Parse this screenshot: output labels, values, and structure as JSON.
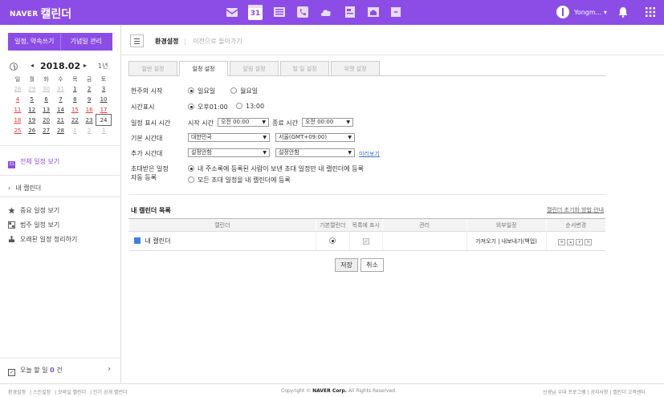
{
  "header": {
    "brand": "NAVER",
    "app_title": "캘린더",
    "user_name": "Yongm...",
    "user_caret": "▾"
  },
  "apps": [
    "mail-icon",
    "calendar-icon",
    "list-icon",
    "contact-icon",
    "cloud-icon",
    "memo-icon",
    "home-icon",
    "more-icon"
  ],
  "calendar_app_label": "31",
  "sidebar": {
    "btn_write": "일정, 약속쓰기",
    "btn_anniv": "기념일 관리",
    "month": "2018.02",
    "prev": "◂",
    "next": "▸",
    "year_view": "1년",
    "weekdays": [
      "일",
      "월",
      "화",
      "수",
      "목",
      "금",
      "토"
    ],
    "weeks": [
      [
        "28",
        "29",
        "30",
        "31",
        "1",
        "2",
        "3"
      ],
      [
        "4",
        "5",
        "6",
        "7",
        "8",
        "9",
        "10"
      ],
      [
        "11",
        "12",
        "13",
        "14",
        "15",
        "16",
        "17"
      ],
      [
        "18",
        "19",
        "20",
        "21",
        "22",
        "23",
        "24"
      ],
      [
        "25",
        "26",
        "27",
        "28",
        "1",
        "2",
        "3"
      ]
    ],
    "all_schedule": "전체 일정 보기",
    "my_calendar": "내 캘린더",
    "important": "중요 일정 보기",
    "past": "범주 일정 보기",
    "cleanup": "오래된 일정 정리하기",
    "today_prefix": "오늘 할 일",
    "today_count": "0",
    "today_suffix": "건",
    "today_arrow": "›"
  },
  "main": {
    "crumb_title": "환경설정",
    "crumb_sep": "|",
    "crumb_back": "이전으로 돌아가기",
    "tabs": [
      "일반 설정",
      "일정 설정",
      "알림 설정",
      "할 일 설정",
      "위젯 설정"
    ],
    "form": {
      "week_start_label": "한주의 시작",
      "week_start_opt1": "일요일",
      "week_start_opt2": "월요일",
      "time_label": "시간표시",
      "time_opt1": "오후01:00",
      "time_opt2": "13:00",
      "display_time_label": "일정 표시 시간",
      "start_label": "시작 시간",
      "start_value": "오전 00:00",
      "end_label": "종료 시간",
      "end_value": "오전 00:00",
      "tz_label": "기본 시간대",
      "tz_country": "대한민국",
      "tz_city": "서울(GMT+09:00)",
      "tz2_label": "추가 시간대",
      "tz2_country": "설정안함",
      "tz2_city": "설정안함",
      "tz2_preview": "미리보기",
      "invite_label1": "초대받은 일정",
      "invite_label2": "자동 등록",
      "invite_opt1": "내 주소록에 등록된 사람이 보낸 초대 일정만 내 캘린더에 등록",
      "invite_opt2": "모든 초대 일정을 내 캘린더에 등록"
    },
    "list_title": "내 캘린더 목록",
    "reset_link": "캘린더 초기화 방법 안내",
    "columns": [
      "캘린더",
      "기본캘린더",
      "목록에 표시",
      "관리",
      "외부일정",
      "순서변경"
    ],
    "row": {
      "name": "내 캘린더",
      "check": "✓",
      "external": "가져오기 | 내보내기(백업)",
      "order": [
        "≡",
        "▴",
        "▾",
        "≡"
      ]
    },
    "save": "저장",
    "cancel": "취소"
  },
  "footer": {
    "links": [
      "환경설정",
      "스킨설정",
      "모바일 캘린더",
      "인기 공개 캘린더"
    ],
    "copyright_prefix": "Copyright ©",
    "company": "NAVER Corp.",
    "rights": "All Rights Reserved.",
    "right_links": [
      "신생님 우대 프로그램",
      "공지사항",
      "캘린더 고객센터"
    ]
  },
  "colors": {
    "brand": "#8b4de6",
    "link": "#3a6fc4",
    "calendar": "#3a82e0",
    "sunday": "#e23b3b"
  }
}
